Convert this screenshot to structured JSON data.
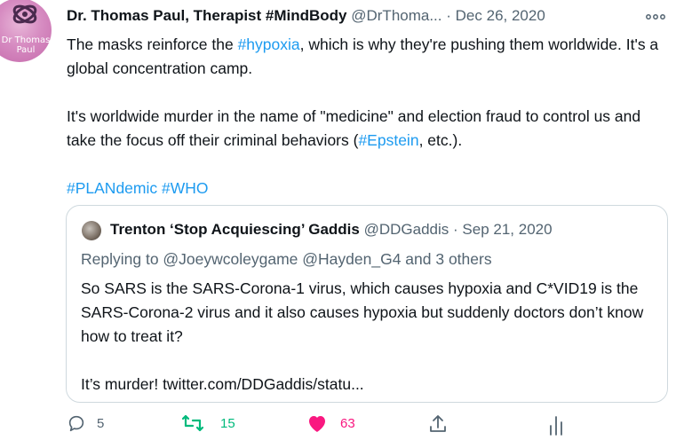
{
  "author": {
    "avatar_text_line1": "Dr Thomas",
    "avatar_text_line2": "Paul",
    "name": "Dr. Thomas Paul, Therapist #MindBody",
    "handle": "@DrThoma...",
    "separator": "·",
    "date": "Dec 26, 2020"
  },
  "tweet": {
    "p1_a": "The masks reinforce the ",
    "p1_tag": "#hypoxia",
    "p1_b": ", which is why they're pushing them worldwide. It's a global concentration camp.",
    "p2_a": "It's worldwide murder in the name of \"medicine\" and election fraud to control us and take the focus off their criminal behaviors (",
    "p2_tag": "#Epstein",
    "p2_b": ", etc.).",
    "p3_tag1": "#PLANdemic",
    "p3_tag2": "#WHO"
  },
  "quote": {
    "name": "Trenton ‘Stop Acquiescing’ Gaddis",
    "handle": "@DDGaddis",
    "separator": "·",
    "date": "Sep 21, 2020",
    "replying_to": "Replying to @Joeywcoleygame @Hayden_G4 and 3 others",
    "text1": "So SARS is the SARS-Corona-1 virus, which causes hypoxia and C*VID19 is the SARS-Corona-2 virus and it also causes hypoxia but suddenly doctors don’t know how to treat it?",
    "text2": "It’s murder! twitter.com/DDGaddis/statu..."
  },
  "actions": {
    "reply_count": "5",
    "retweet_count": "15",
    "like_count": "63"
  },
  "colors": {
    "link": "#1d9bf0",
    "retweet": "#00ba7c",
    "like": "#f91880",
    "muted": "#536471"
  },
  "icons": [
    "more-icon",
    "reply-icon",
    "retweet-icon",
    "like-icon",
    "share-icon",
    "analytics-icon"
  ]
}
